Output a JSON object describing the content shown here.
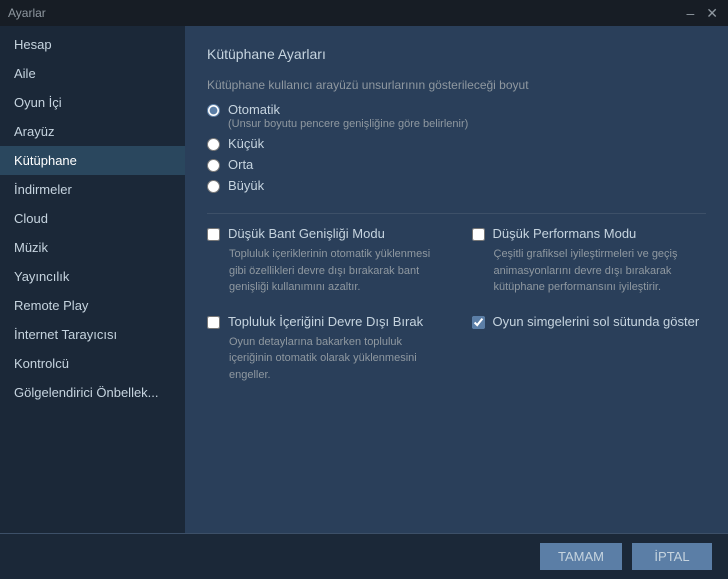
{
  "titleBar": {
    "title": "Ayarlar",
    "minimizeLabel": "–",
    "closeLabel": "✕"
  },
  "sidebar": {
    "items": [
      {
        "id": "hesap",
        "label": "Hesap",
        "active": false
      },
      {
        "id": "aile",
        "label": "Aile",
        "active": false
      },
      {
        "id": "oyun-ici",
        "label": "Oyun İçi",
        "active": false
      },
      {
        "id": "arayuz",
        "label": "Arayüz",
        "active": false
      },
      {
        "id": "kutuphane",
        "label": "Kütüphane",
        "active": true
      },
      {
        "id": "indirmeler",
        "label": "İndirmeler",
        "active": false
      },
      {
        "id": "cloud",
        "label": "Cloud",
        "active": false
      },
      {
        "id": "muzik",
        "label": "Müzik",
        "active": false
      },
      {
        "id": "yayincilik",
        "label": "Yayıncılık",
        "active": false
      },
      {
        "id": "remote-play",
        "label": "Remote Play",
        "active": false
      },
      {
        "id": "internet-tarayicisi",
        "label": "İnternet Tarayıcısı",
        "active": false
      },
      {
        "id": "kontrolcu",
        "label": "Kontrolcü",
        "active": false
      },
      {
        "id": "golgelendirici",
        "label": "Gölgelendirici Önbellek...",
        "active": false
      }
    ]
  },
  "content": {
    "sectionTitle": "Kütüphane Ayarları",
    "uiSizeLabel": "Kütüphane kullanıcı arayüzü unsurlarının gösterileceği boyut",
    "radioOptions": [
      {
        "id": "otomatik",
        "label": "Otomatik",
        "sublabel": "(Unsur boyutu pencere genişliğine göre belirlenir)",
        "checked": true
      },
      {
        "id": "kucuk",
        "label": "Küçük",
        "sublabel": "",
        "checked": false
      },
      {
        "id": "orta",
        "label": "Orta",
        "sublabel": "",
        "checked": false
      },
      {
        "id": "buyuk",
        "label": "Büyük",
        "sublabel": "",
        "checked": false
      }
    ],
    "checkboxes": [
      {
        "id": "dusuk-bant",
        "label": "Düşük Bant Genişliği Modu",
        "desc": "Topluluk içeriklerinin otomatik yüklenmesi gibi özellikleri devre dışı bırakarak bant genişliği kullanımını azaltır.",
        "checked": false
      },
      {
        "id": "dusuk-performans",
        "label": "Düşük Performans Modu",
        "desc": "Çeşitli grafiksel iyileştirmeleri ve geçiş animasyonlarını devre dışı bırakarak kütüphane performansını iyileştirir.",
        "checked": false
      },
      {
        "id": "topluluk-devre-disi",
        "label": "Topluluk İçeriğini Devre Dışı Bırak",
        "desc": "Oyun detaylarına bakarken topluluk içeriğinin otomatik olarak yüklenmesini engeller.",
        "checked": false
      },
      {
        "id": "oyun-simgeleri",
        "label": "Oyun simgelerini sol sütunda göster",
        "desc": "",
        "checked": true
      }
    ]
  },
  "footer": {
    "okLabel": "TAMAM",
    "cancelLabel": "İPTAL"
  }
}
